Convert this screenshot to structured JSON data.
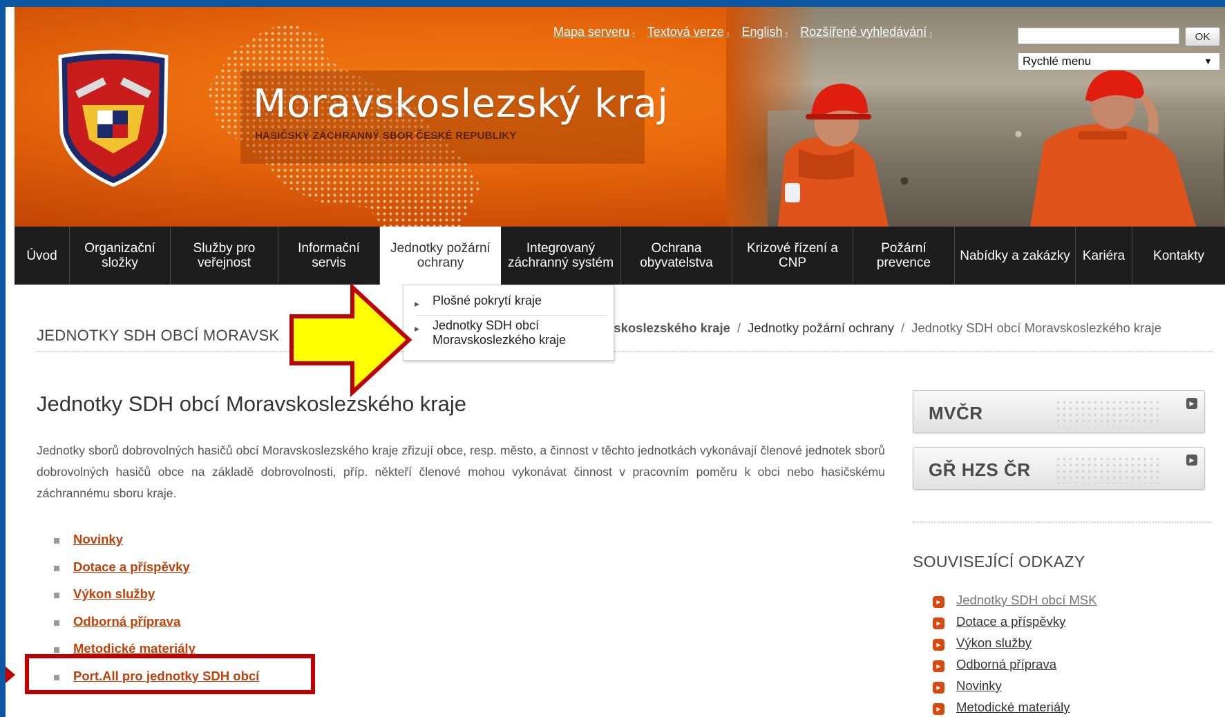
{
  "header": {
    "title": "Moravskoslezský kraj",
    "subtitle": "HASIČSKÝ ZÁCHRANNÝ SBOR ČESKÉ REPUBLIKY",
    "top_links": [
      "Mapa serveru",
      "Textová verze",
      "English",
      "Rozšířené vyhledávání"
    ],
    "search": {
      "value": "",
      "button": "OK"
    },
    "quick_menu": {
      "selected": "Rychlé menu"
    }
  },
  "nav": {
    "items": [
      "Úvod",
      "Organizační složky",
      "Služby pro veřejnost",
      "Informační servis",
      "Jednotky požární ochrany",
      "Integrovaný záchranný systém",
      "Ochrana obyvatelstva",
      "Krizové řízení a CNP",
      "Požární prevence",
      "Nabídky a zakázky",
      "Kariéra",
      "Kontakty"
    ],
    "active_index": 4,
    "dropdown": [
      "Plošné pokrytí kraje",
      "Jednotky SDH obcí Moravskoslezkého kraje"
    ]
  },
  "section_title": "JEDNOTKY SDH OBCÍ MORAVSK",
  "breadcrumb": [
    "vskoslezského kraje",
    "Jednotky požární ochrany",
    "Jednotky SDH obcí Moravskoslezkého kraje"
  ],
  "main": {
    "heading": "Jednotky SDH obcí Moravskoslezského kraje",
    "intro": "Jednotky sborů dobrovolných hasičů obcí Moravskoslezského kraje zřizují obce, resp. město, a činnost v těchto jednotkách vykonávají členové jednotek sborů dobrovolných hasičů obce na základě dobrovolnosti, příp. někteří členové mohou vykonávat činnost v pracovním poměru k obci nebo hasičskému záchrannému sboru kraje.",
    "links": [
      "Novinky",
      "Dotace a příspěvky",
      "Výkon služby",
      "Odborná příprava",
      "Metodické materiály",
      "Port.All pro jednotky SDH obcí"
    ]
  },
  "sidebar": {
    "buttons": [
      "MVČR",
      "GŘ HZS ČR"
    ],
    "related_title": "SOUVISEJÍCÍ ODKAZY",
    "related_links": [
      "Jednotky SDH obcí MSK",
      "Dotace a příspěvky",
      "Výkon služby",
      "Odborná příprava",
      "Novinky",
      "Metodické materiály"
    ]
  },
  "colors": {
    "brand_orange": "#e8690c",
    "nav_bg": "#1d1d1d",
    "link_red": "#c1410a",
    "highlight_red": "#c00000",
    "arrow_yellow": "#ffff00",
    "frame_blue": "#0c56a2"
  }
}
